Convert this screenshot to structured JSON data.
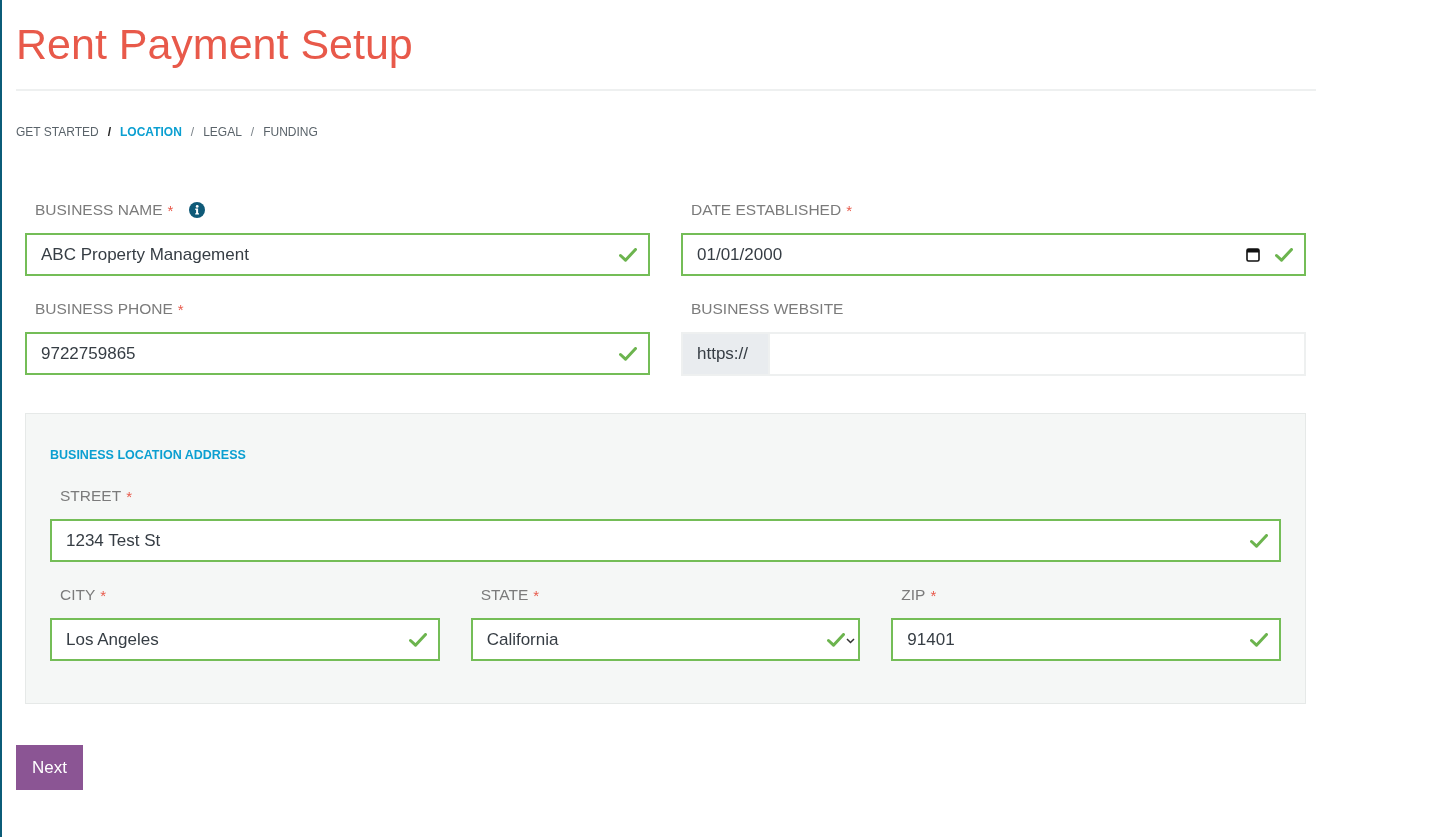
{
  "page": {
    "title": "Rent Payment Setup"
  },
  "breadcrumb": [
    {
      "label": "GET STARTED",
      "selected": false
    },
    {
      "separator": "/",
      "label": "LOCATION",
      "selected": true
    },
    {
      "separator": "/",
      "label": "LEGAL",
      "selected": false
    },
    {
      "separator": "/",
      "label": "FUNDING",
      "selected": false
    }
  ],
  "fields": [
    {
      "kind": "text",
      "label": "BUSINESS NAME",
      "required_mark": "*",
      "info": true,
      "value": "ABC Property Management",
      "valid": true
    },
    {
      "kind": "date",
      "label": "DATE ESTABLISHED",
      "required_mark": "*",
      "value": "01/01/2000",
      "valid": true
    },
    {
      "kind": "text",
      "label": "BUSINESS PHONE",
      "required_mark": "*",
      "value": "9722759865",
      "valid": true
    },
    {
      "kind": "prefixed",
      "label": "BUSINESS WEBSITE",
      "prefix": "https://",
      "valid": false
    }
  ],
  "address": {
    "heading": "BUSINESS LOCATION ADDRESS",
    "street": {
      "kind": "text",
      "label": "STREET",
      "required_mark": "*",
      "value": "1234 Test St",
      "valid": true
    },
    "locality": [
      {
        "kind": "text",
        "label": "CITY",
        "required_mark": "*",
        "value": "Los Angeles",
        "valid": true
      },
      {
        "kind": "select",
        "label": "STATE",
        "required_mark": "*",
        "value": "California",
        "valid": true
      },
      {
        "kind": "text",
        "label": "ZIP",
        "required_mark": "*",
        "value": "91401",
        "valid": true
      }
    ]
  },
  "next_button": {
    "label": "Next"
  }
}
